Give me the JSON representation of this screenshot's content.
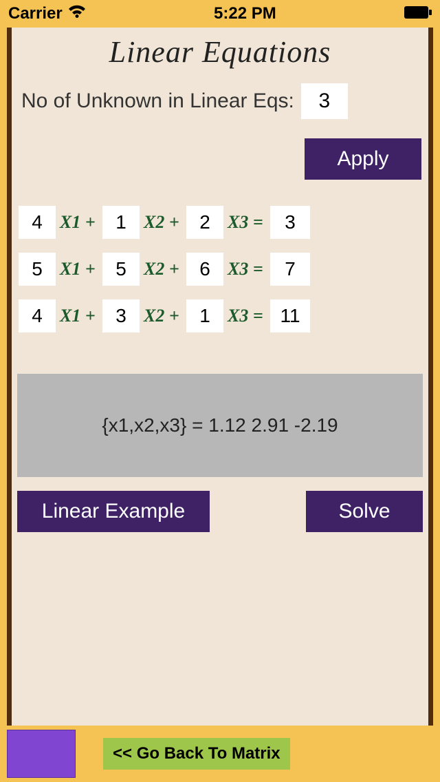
{
  "status": {
    "carrier": "Carrier",
    "time": "5:22 PM"
  },
  "title": "Linear Equations",
  "unknowns": {
    "label": "No of Unknown in Linear Eqs:",
    "value": "3"
  },
  "buttons": {
    "apply": "Apply",
    "example": "Linear Example",
    "solve": "Solve",
    "back": "<< Go Back To Matrix"
  },
  "labels": {
    "x1p": "X1 +",
    "x2p": "X2 +",
    "x3e": "X3 ="
  },
  "equations": [
    {
      "c1": "4",
      "c2": "1",
      "c3": "2",
      "rhs": "3"
    },
    {
      "c1": "5",
      "c2": "5",
      "c3": "6",
      "rhs": "7"
    },
    {
      "c1": "4",
      "c2": "3",
      "c3": "1",
      "rhs": "11"
    }
  ],
  "result": "{x1,x2,x3} =  1.12 2.91 -2.19"
}
